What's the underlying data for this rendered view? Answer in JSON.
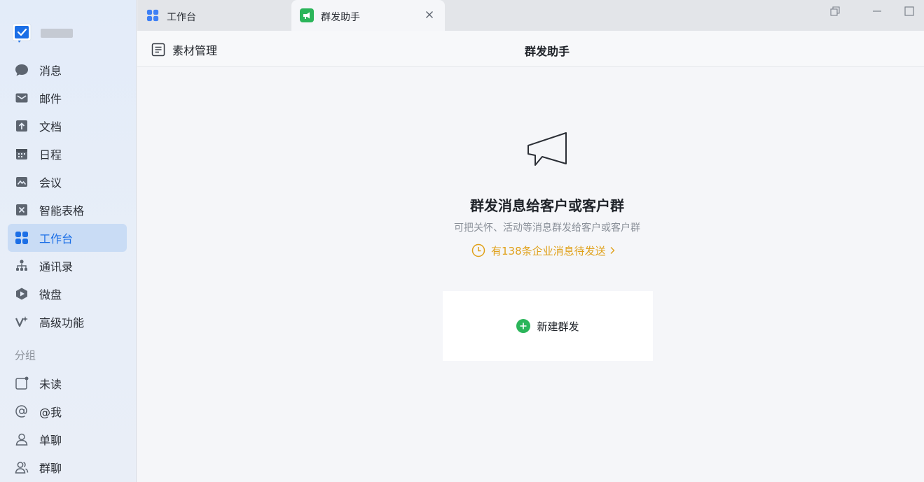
{
  "sidebar": {
    "items": [
      {
        "label": "消息",
        "icon": "chat-bubble-icon"
      },
      {
        "label": "邮件",
        "icon": "mail-icon"
      },
      {
        "label": "文档",
        "icon": "document-icon"
      },
      {
        "label": "日程",
        "icon": "calendar-icon"
      },
      {
        "label": "会议",
        "icon": "meeting-icon"
      },
      {
        "label": "智能表格",
        "icon": "smart-sheet-icon"
      },
      {
        "label": "工作台",
        "icon": "workbench-grid-icon",
        "active": true
      },
      {
        "label": "通讯录",
        "icon": "org-tree-icon"
      },
      {
        "label": "微盘",
        "icon": "drive-icon"
      },
      {
        "label": "高级功能",
        "icon": "sparkle-icon"
      }
    ],
    "group_title": "分组",
    "group_items": [
      {
        "label": "未读",
        "icon": "unread-icon"
      },
      {
        "label": "@我",
        "icon": "at-icon"
      },
      {
        "label": "单聊",
        "icon": "single-user-icon"
      },
      {
        "label": "群聊",
        "icon": "group-users-icon"
      }
    ]
  },
  "tabs": [
    {
      "label": "工作台",
      "icon": "workbench-grid-icon"
    },
    {
      "label": "群发助手",
      "icon": "megaphone-icon",
      "active": true
    }
  ],
  "header": {
    "material_label": "素材管理",
    "title": "群发助手"
  },
  "empty_state": {
    "title": "群发消息给客户或客户群",
    "subtitle": "可把关怀、活动等消息群发给客户或客户群",
    "pending_text": "有138条企业消息待发送",
    "new_button": "新建群发"
  },
  "colors": {
    "accent": "#1c6fe6",
    "active_bg": "#c9dcf5",
    "green": "#2bb55a",
    "pending": "#e0a11b"
  }
}
